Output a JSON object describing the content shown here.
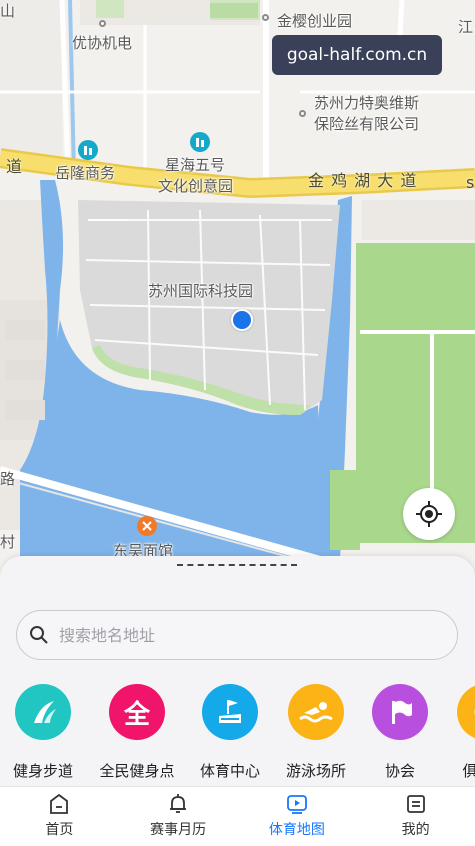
{
  "watermark": "goal-half.com.cn",
  "map": {
    "labels": {
      "top_left_cut": "山",
      "jinying": "金樱创业园",
      "jiang_cut": "江",
      "youxie": "优协机电",
      "lite_line1": "苏州力特奥维斯",
      "lite_line2": "保险丝有限公司",
      "xinghai_line1": "星海五号",
      "xinghai_line2": "文化创意园",
      "yuelong": "岳隆商务",
      "road_left": "道",
      "road_jinji": "金 鸡 湖 大 道",
      "road_right_cut": "s",
      "park": "苏州国际科技园",
      "road_lu": "路",
      "cun_cut": "村",
      "dongwu": "东吴面馆"
    }
  },
  "panel": {
    "search_placeholder": "搜索地名地址",
    "categories": [
      {
        "label": "健身步道",
        "icon": "trail-icon",
        "color": "#21c6c2"
      },
      {
        "label": "全民健身点",
        "icon": "quan-icon",
        "color": "#f0146a",
        "glyph": "全"
      },
      {
        "label": "体育中心",
        "icon": "stadium-icon",
        "color": "#14a9e8"
      },
      {
        "label": "游泳场所",
        "icon": "swimming-icon",
        "color": "#fbb316"
      },
      {
        "label": "协会",
        "icon": "flag-icon",
        "color": "#b94fdf"
      },
      {
        "label": "俱乐部",
        "icon": "club-icon",
        "color": "#fbb316"
      }
    ]
  },
  "tabbar": {
    "items": [
      {
        "label": "首页",
        "icon": "home-icon",
        "active": false
      },
      {
        "label": "赛事月历",
        "icon": "bell-icon",
        "active": false
      },
      {
        "label": "体育地图",
        "icon": "play-map-icon",
        "active": true
      },
      {
        "label": "我的",
        "icon": "profile-icon",
        "active": false
      }
    ],
    "active_color": "#1677ff"
  }
}
